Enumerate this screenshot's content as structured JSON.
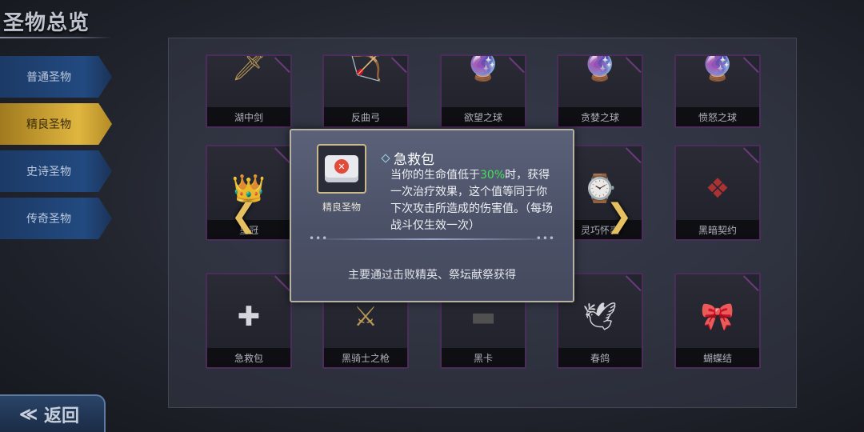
{
  "header": {
    "title": "圣物总览"
  },
  "tabs": [
    {
      "label": "普通圣物",
      "active": false
    },
    {
      "label": "精良圣物",
      "active": true
    },
    {
      "label": "史诗圣物",
      "active": false
    },
    {
      "label": "传奇圣物",
      "active": false
    }
  ],
  "back_label": "返回",
  "grid": {
    "row1": [
      "湖中剑",
      "反曲弓",
      "欲望之球",
      "贪婪之球",
      "愤怒之球"
    ],
    "row2": [
      "皇冠",
      "灵巧怀表",
      "黑暗契约"
    ],
    "row3": [
      "急救包",
      "黑骑士之枪",
      "黑卡",
      "春鸽",
      "蝴蝶结"
    ]
  },
  "popup": {
    "name": "急救包",
    "rarity": "精良圣物",
    "desc_before": "当你的生命值低于",
    "desc_highlight": "30%",
    "desc_after": "时，获得一次治疗效果，这个值等同于你下次攻击所造成的伤害值。（每场战斗仅生效一次）",
    "source": "主要通过击败精英、祭坛献祭获得",
    "highlight_color": "#43e05a"
  },
  "colors": {
    "active_tab": "#e0b640",
    "tab": "#224a80",
    "card_border": "#4b2c5a"
  }
}
